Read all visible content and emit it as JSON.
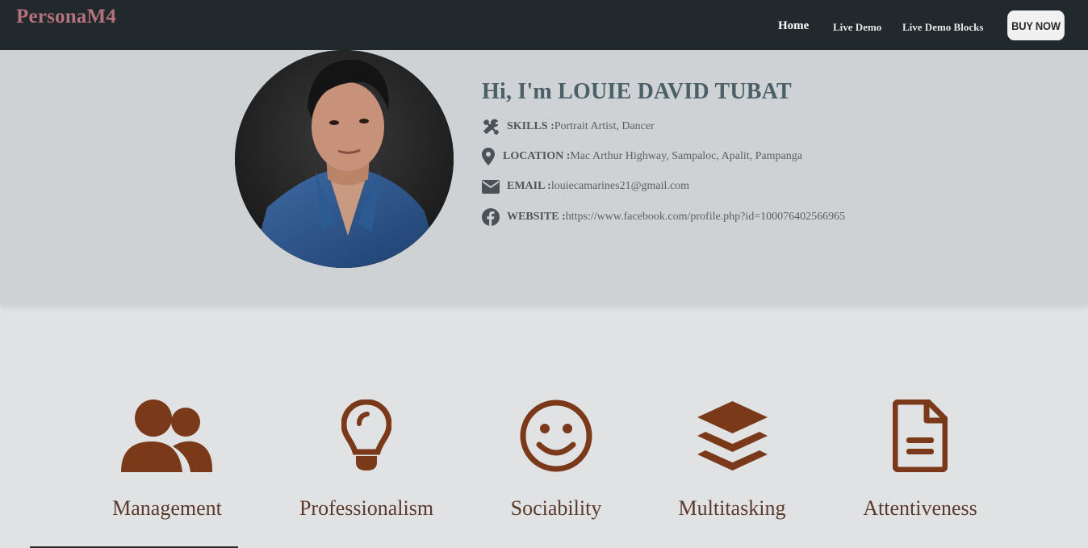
{
  "nav": {
    "brand": "PersonaM4",
    "links": [
      "Home",
      "Live Demo",
      "Live Demo Blocks"
    ],
    "buy_label": "BUY NOW"
  },
  "profile": {
    "greeting": "Hi, I'm LOUIE DAVID TUBAT",
    "rows": [
      {
        "label": "SKILLS :",
        "value": "Portrait Artist, Dancer",
        "icon": "tools-icon"
      },
      {
        "label": "LOCATION :",
        "value": "Mac Arthur Highway, Sampaloc, Apalit, Pampanga",
        "icon": "map-pin-icon"
      },
      {
        "label": "EMAIL :",
        "value": "louiecamarines21@gmail.com",
        "icon": "envelope-icon"
      },
      {
        "label": "WEBSITE :",
        "value": "https://www.facebook.com/profile.php?id=100076402566965",
        "icon": "facebook-icon"
      }
    ]
  },
  "traits": [
    {
      "label": "Management",
      "icon": "users-icon"
    },
    {
      "label": "Professionalism",
      "icon": "lightbulb-icon"
    },
    {
      "label": "Sociability",
      "icon": "smile-icon"
    },
    {
      "label": "Multitasking",
      "icon": "layers-icon"
    },
    {
      "label": "Attentiveness",
      "icon": "document-icon"
    }
  ],
  "colors": {
    "navbar": "#21292d",
    "brand": "#b5727c",
    "profile_bg": "#cfd2d5",
    "heading": "#4a5f66",
    "trait_icon": "#7a3a1a",
    "trait_text": "#5a3a2c"
  }
}
